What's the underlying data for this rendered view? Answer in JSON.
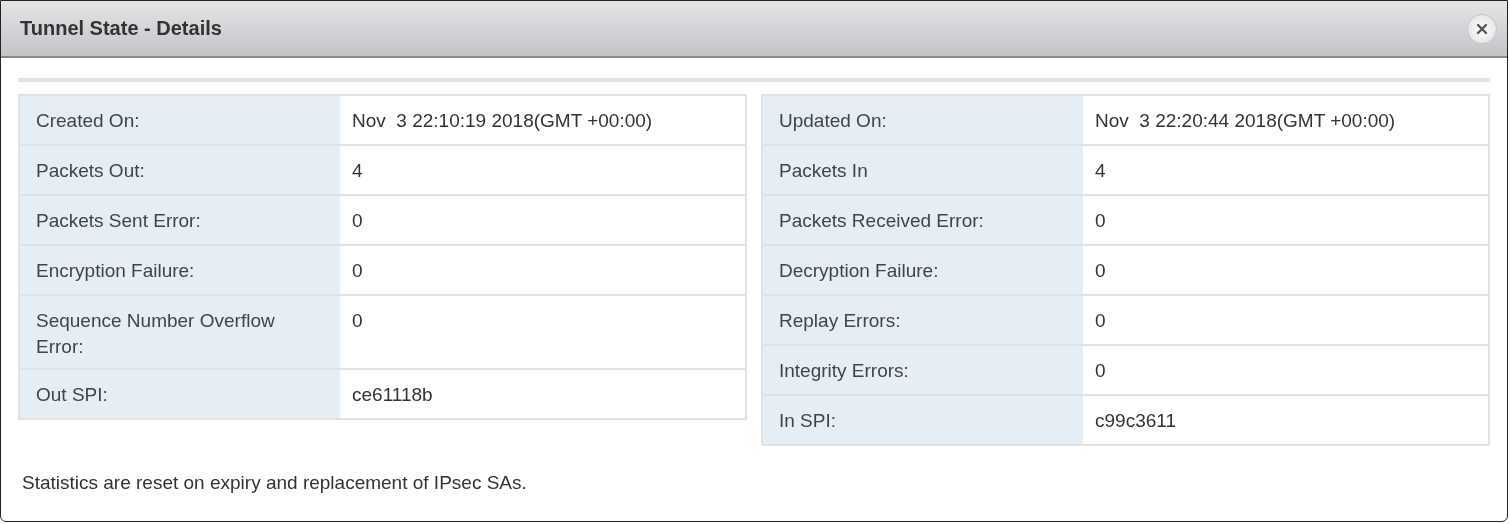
{
  "window": {
    "title": "Tunnel State - Details"
  },
  "tables": [
    {
      "rows": [
        {
          "label": "Created On:",
          "value": "Nov  3 22:10:19 2018(GMT +00:00)"
        },
        {
          "label": "Packets Out:",
          "value": "4"
        },
        {
          "label": "Packets Sent Error:",
          "value": "0"
        },
        {
          "label": "Encryption Failure:",
          "value": "0"
        },
        {
          "label": "Sequence Number Overflow Error:",
          "value": "0"
        },
        {
          "label": "Out SPI:",
          "value": "ce61118b"
        }
      ]
    },
    {
      "rows": [
        {
          "label": "Updated On:",
          "value": "Nov  3 22:20:44 2018(GMT +00:00)"
        },
        {
          "label": "Packets In",
          "value": "4"
        },
        {
          "label": "Packets Received Error:",
          "value": "0"
        },
        {
          "label": "Decryption Failure:",
          "value": "0"
        },
        {
          "label": "Replay Errors:",
          "value": "0"
        },
        {
          "label": "Integrity Errors:",
          "value": "0"
        },
        {
          "label": "In SPI:",
          "value": "c99c3611"
        }
      ]
    }
  ],
  "note": "Statistics are reset on expiry and replacement of IPsec SAs."
}
